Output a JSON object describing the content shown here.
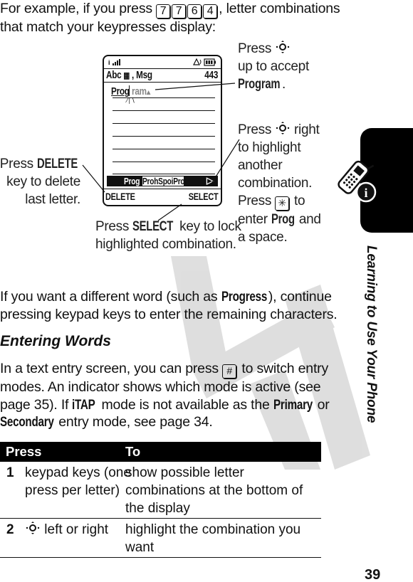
{
  "intro": {
    "before_keys": "For example, if you press ",
    "keys": [
      "7",
      "7",
      "6",
      "4"
    ],
    "after_keys": ", letter combinations that match your keypresses display:"
  },
  "phone_screen": {
    "status_left": "signal",
    "status_right": "ringer-battery",
    "header_left": "Abc",
    "header_mid": "Msg",
    "header_right": "443",
    "entry_typed": "Prog",
    "entry_suggest": "ram",
    "combos": [
      "Prog",
      "ProhSpoiProi"
    ],
    "softkey_left": "DELETE",
    "softkey_right": "SELECT"
  },
  "callouts": {
    "up_accept": {
      "line1_pre": "Press ",
      "line2": "up to accept",
      "term": "Program",
      "post": "."
    },
    "right_highlight": {
      "pre": "Press ",
      "post1": " right",
      "lines": [
        "to highlight",
        "another",
        "combination."
      ],
      "press2_pre": "Press ",
      "press2_post": " to",
      "enter_pre": "enter ",
      "term": "Prog",
      "enter_post": " and",
      "last": "a space."
    },
    "delete": {
      "pre": "Press ",
      "term": "DELETE",
      "line2": "key to delete",
      "line3": "last letter."
    },
    "select": {
      "pre": "Press ",
      "term": "SELECT",
      "post": " key to lock",
      "line2": "highlighted combination."
    }
  },
  "para1": {
    "pre": "If you want a different word (such as ",
    "term": "Progress",
    "post": "), continue pressing keypad keys to enter the remaining characters."
  },
  "section_heading": "Entering Words",
  "para2": {
    "a": "In a text entry screen, you can press ",
    "key": "#",
    "b": " to switch entry modes. An indicator shows which mode is active (see page 35). If ",
    "itap": "iTAP",
    "c": " mode is not available as the ",
    "primary": "Primary",
    "d": " or ",
    "secondary": "Secondary",
    "e": " entry mode, see page 34."
  },
  "table": {
    "headers": [
      "Press",
      "To"
    ],
    "rows": [
      {
        "num": "1",
        "press": "keypad keys (one press per letter)",
        "to": "show possible letter combinations at the bottom of the display"
      },
      {
        "num": "2",
        "press": " left or right",
        "to": "highlight the combination you want"
      }
    ]
  },
  "sidebar": {
    "title": "Learning to Use Your Phone"
  },
  "page_number": "39",
  "watermark_text": "DRAFT"
}
